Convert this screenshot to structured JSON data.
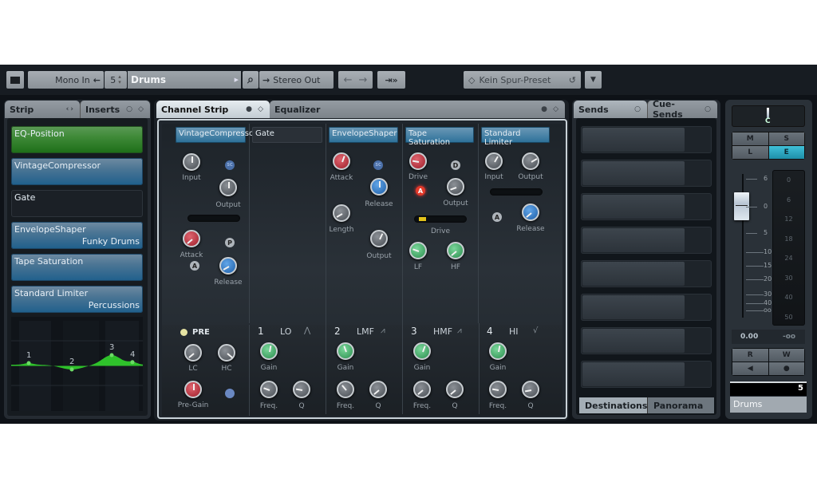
{
  "toolbar": {
    "layout_icon": "layout-icon",
    "input_routing": "Mono In",
    "input_arrow": "←",
    "track_number": "5",
    "track_name": "Drums",
    "search_icon": "⌕",
    "output_arrow": "→",
    "output_routing": "Stereo Out",
    "nav_back": "←",
    "nav_forward": "→",
    "export_icon": "⇥»",
    "preset_icon": "◇",
    "preset_name": "Kein Spur-Preset",
    "preset_reload": "↺",
    "preset_dropdown": "▼"
  },
  "left_panel": {
    "tabs": [
      {
        "label": "Strip",
        "icon": "‹›"
      },
      {
        "label": "Inserts",
        "icon": "○ ◇"
      }
    ],
    "slots": [
      {
        "name": "EQ-Position",
        "preset": "",
        "style": "green"
      },
      {
        "name": "VintageCompressor",
        "preset": "",
        "style": "blue"
      },
      {
        "name": "Gate",
        "preset": "",
        "style": "dark"
      },
      {
        "name": "EnvelopeShaper",
        "preset": "Funky Drums",
        "style": "blue"
      },
      {
        "name": "Tape Saturation",
        "preset": "",
        "style": "blue"
      },
      {
        "name": "Standard Limiter",
        "preset": "Percussions",
        "style": "blue"
      }
    ],
    "eq_curve": {
      "bands": [
        {
          "label": "1",
          "gain_fraction": 0.05
        },
        {
          "label": "2",
          "gain_fraction": -0.15
        },
        {
          "label": "3",
          "gain_fraction": 0.3
        },
        {
          "label": "4",
          "gain_fraction": 0.08
        }
      ],
      "color": "#2fc22b"
    }
  },
  "center_panel": {
    "tabs": [
      {
        "label": "Channel Strip",
        "icon": "● ◇"
      },
      {
        "label": "Equalizer",
        "icon": "● ◇"
      }
    ],
    "modules": {
      "vintage_compressor": {
        "title": "VintageCompressor",
        "input": "Input",
        "output": "Output",
        "attack": "Attack",
        "release": "Release",
        "sc": "SC",
        "p": "P",
        "a": "A"
      },
      "gate": {
        "title": "Gate"
      },
      "envelope_shaper": {
        "title": "EnvelopeShaper",
        "attack": "Attack",
        "release": "Release",
        "length": "Length",
        "output": "Output",
        "sc": "SC"
      },
      "tape_saturation": {
        "title": "Tape Saturation",
        "drive": "Drive",
        "output": "Output",
        "drive_meter": "Drive",
        "lf": "LF",
        "hf": "HF",
        "d": "D",
        "a": "A"
      },
      "standard_limiter": {
        "title": "Standard Limiter",
        "input": "Input",
        "output": "Output",
        "release": "Release",
        "a": "A"
      }
    },
    "pre_section": {
      "label": "PRE",
      "lc": "LC",
      "hc": "HC",
      "pre_gain": "Pre-Gain"
    },
    "eq_bands": [
      {
        "num": "1",
        "name": "LO",
        "shape": "⋀",
        "gain": "Gain",
        "freq": "Freq.",
        "q": "Q"
      },
      {
        "num": "2",
        "name": "LMF",
        "shape": "⩘",
        "gain": "Gain",
        "freq": "Freq.",
        "q": "Q"
      },
      {
        "num": "3",
        "name": "HMF",
        "shape": "⩘",
        "gain": "Gain",
        "freq": "Freq.",
        "q": "Q"
      },
      {
        "num": "4",
        "name": "HI",
        "shape": "√",
        "gain": "Gain",
        "freq": "Freq.",
        "q": "Q"
      }
    ]
  },
  "sends_panel": {
    "tabs": [
      {
        "label": "Sends",
        "icon": "○"
      },
      {
        "label": "Cue-Sends",
        "icon": "○"
      }
    ],
    "slot_count": 8,
    "bottom_tabs": [
      "Destinations",
      "Panorama"
    ]
  },
  "fader_panel": {
    "pan_label": "C",
    "buttons_top": [
      "M",
      "S",
      "L",
      "E"
    ],
    "fader_scale": [
      "6",
      "0",
      "5",
      "10",
      "15",
      "20",
      "30",
      "40",
      "oo"
    ],
    "meter_scale": [
      "0",
      "6",
      "12",
      "18",
      "24",
      "30",
      "40",
      "50"
    ],
    "volume_value": "0.00",
    "peak_value": "-oo",
    "buttons_bottom": [
      "R",
      "W",
      "◀",
      "●"
    ],
    "track_number": "5",
    "track_name": "Drums",
    "active_button_color": "#2aa6bf"
  }
}
